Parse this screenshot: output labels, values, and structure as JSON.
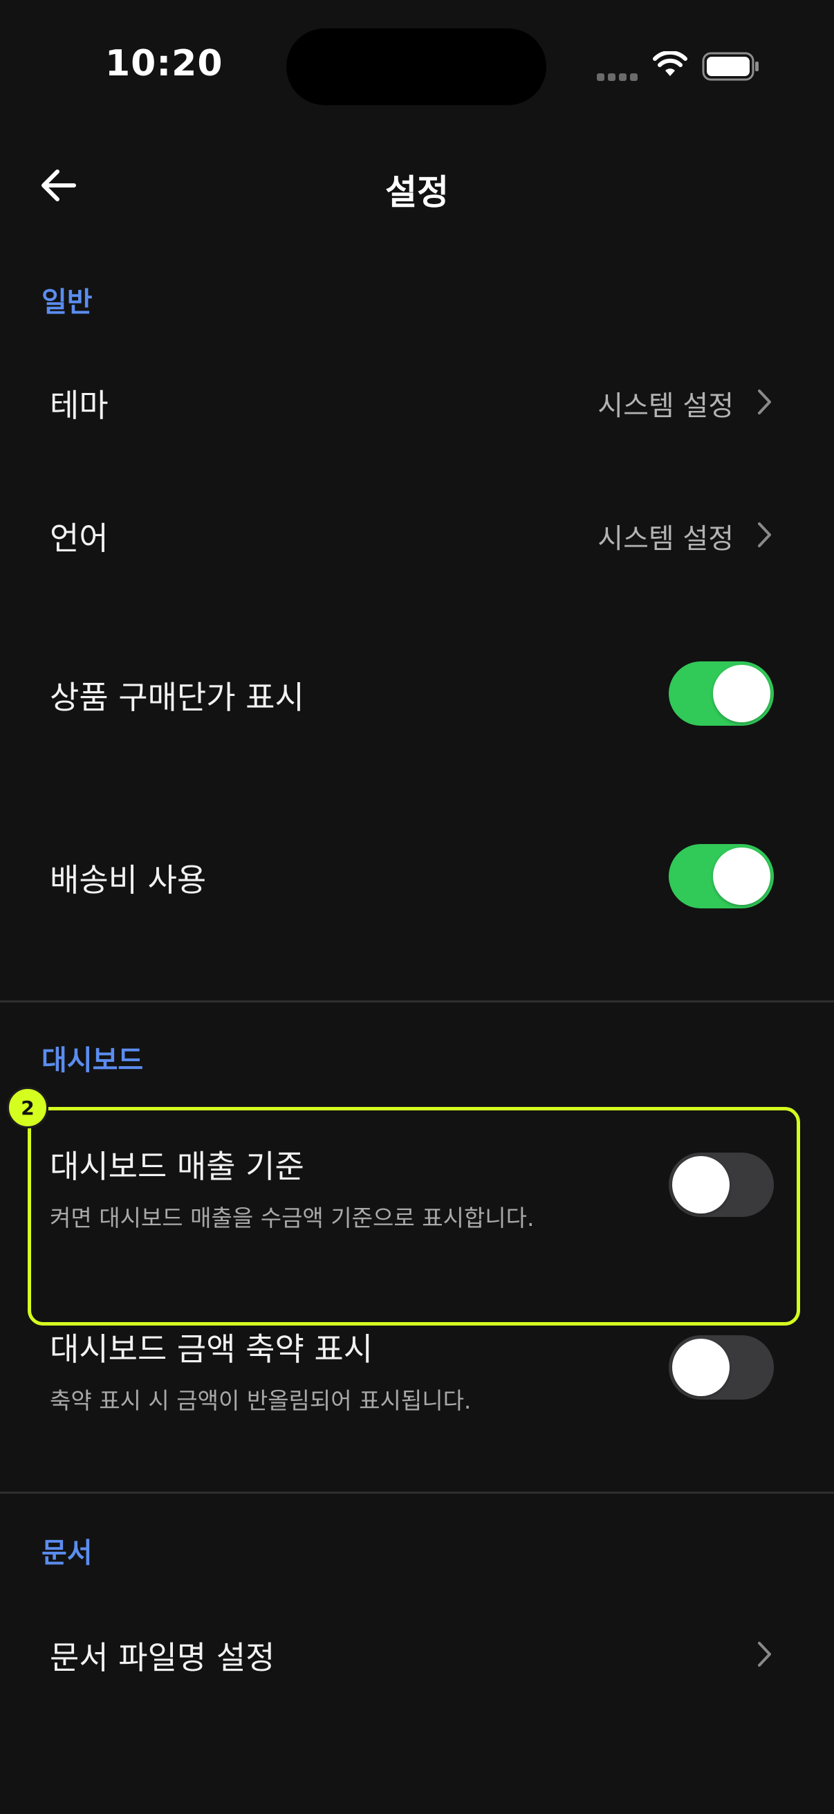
{
  "status_bar": {
    "time": "10:20"
  },
  "header": {
    "back_icon": "arrow-left-icon",
    "title": "설정"
  },
  "sections": {
    "general": {
      "title": "일반",
      "theme": {
        "label": "테마",
        "value": "시스템 설정"
      },
      "language": {
        "label": "언어",
        "value": "시스템 설정"
      },
      "purchase_price": {
        "label": "상품 구매단가 표시",
        "enabled": true
      },
      "shipping_fee": {
        "label": "배송비 사용",
        "enabled": true
      }
    },
    "dashboard": {
      "title": "대시보드",
      "sales_basis": {
        "label": "대시보드 매출 기준",
        "description": "켜면 대시보드 매출을 수금액 기준으로 표시합니다.",
        "enabled": false
      },
      "amount_abbrev": {
        "label": "대시보드 금액 축약 표시",
        "description": "축약 표시 시 금액이 반올림되어 표시됩니다.",
        "enabled": false
      }
    },
    "documents": {
      "title": "문서",
      "filename": {
        "label": "문서 파일명 설정"
      }
    }
  },
  "annotation": {
    "badge": "2",
    "color": "#d4ff1f"
  },
  "colors": {
    "accent": "#5b8def",
    "toggle_on": "#31c958",
    "toggle_off": "#3a3a3c",
    "background": "#121212"
  }
}
